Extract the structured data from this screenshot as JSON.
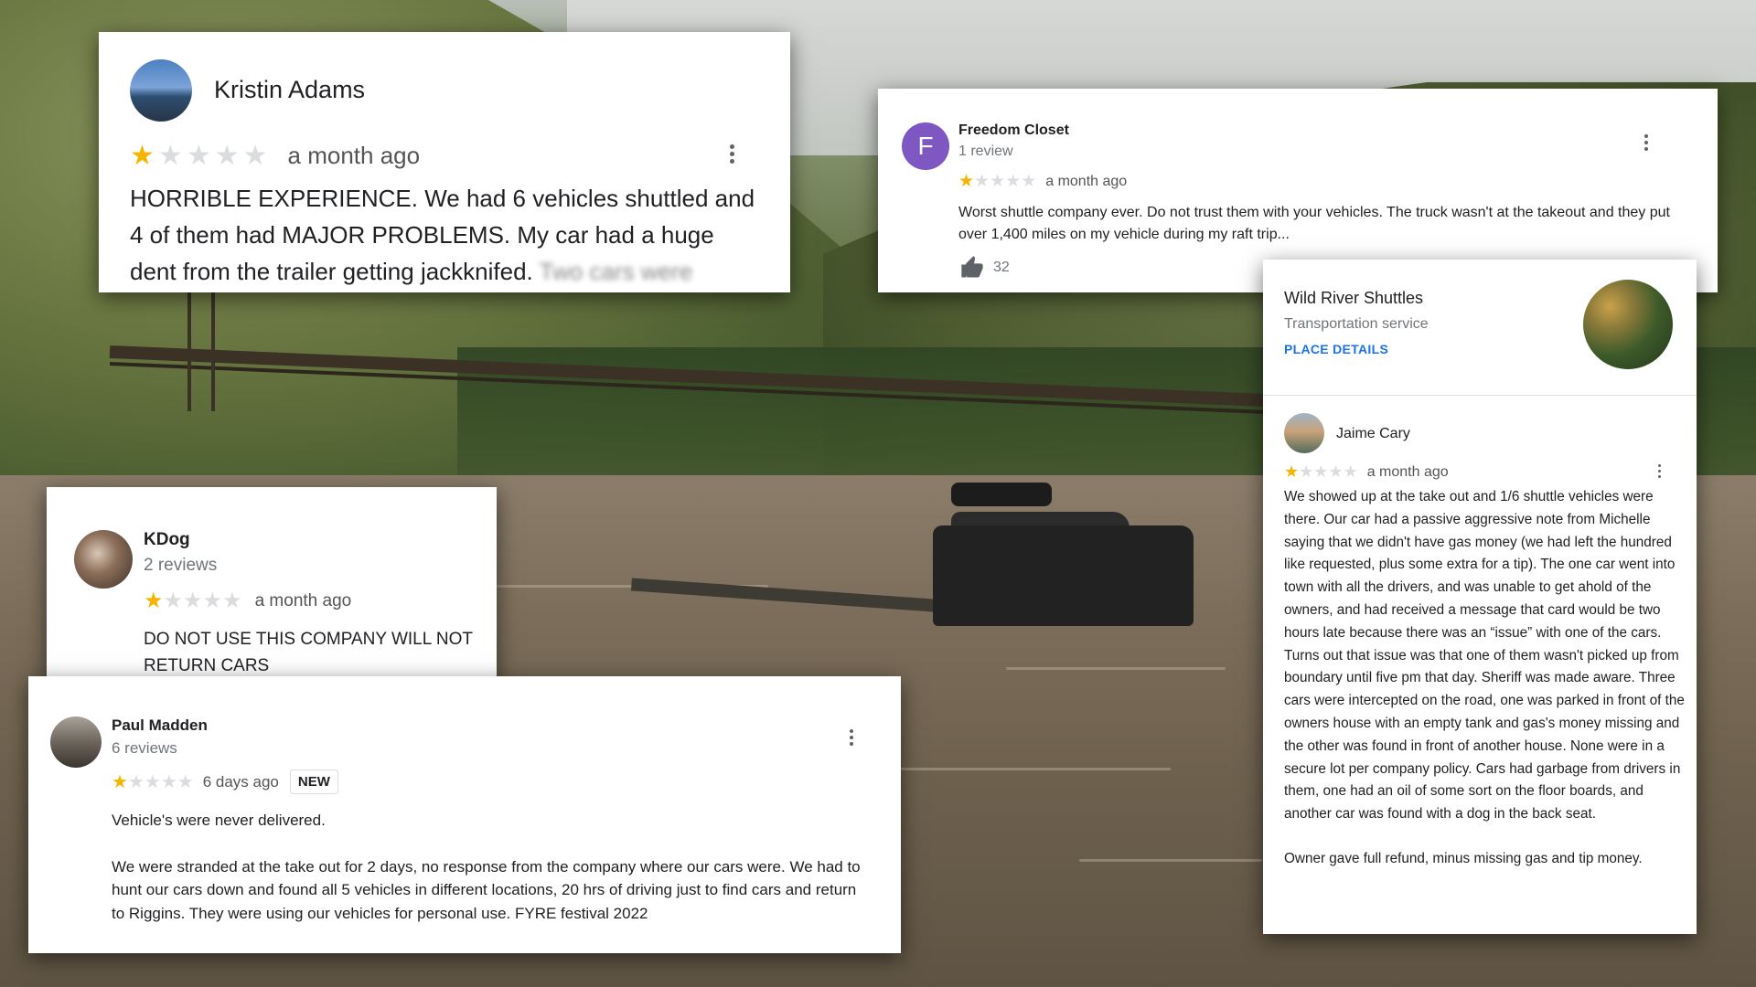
{
  "reviews": {
    "kristin": {
      "name": "Kristin Adams",
      "stars_filled": 1,
      "stars_total": 5,
      "time": "a month ago",
      "text": "HORRIBLE EXPERIENCE.  We had 6 vehicles shuttled and 4 of them had MAJOR PROBLEMS.  My car had a huge dent from the trailer getting jackknifed.",
      "text_blurred": "Two cars were"
    },
    "freedom": {
      "avatar_letter": "F",
      "name": "Freedom Closet",
      "review_count": "1 review",
      "stars_filled": 1,
      "time": "a month ago",
      "text": "Worst shuttle company ever. Do not trust them with your vehicles. The truck wasn't at the takeout and they put over 1,400 miles on my vehicle during my raft trip...",
      "likes": "32"
    },
    "wild_river": {
      "business_name": "Wild River Shuttles",
      "business_type": "Transportation service",
      "place_details": "PLACE DETAILS",
      "reviewer": "Jaime Cary",
      "stars_filled": 1,
      "time": "a month ago",
      "paragraph1": "We showed up at the take out and 1/6 shuttle vehicles were there. Our car had a passive aggressive note from Michelle saying that we didn't have gas money (we had left the hundred like requested, plus some extra for a tip). The one car went into town with all the drivers, and was unable to get ahold of the owners, and had received a message that card would be two hours late because there was an “issue” with one of the cars. Turns out that issue was that one of them wasn't picked up from boundary until five pm that day. Sheriff was made aware. Three cars were intercepted on the road, one was parked in front of the owners house with an empty tank and gas's money missing and the other was found in front of another house. None were in a secure lot per company policy. Cars had garbage from drivers in them, one had an oil of some sort on the floor boards, and another car was found with a dog in the back seat.",
      "paragraph2": "Owner gave full refund, minus missing gas and tip money."
    },
    "kdog": {
      "name": "KDog",
      "review_count": "2 reviews",
      "stars_filled": 1,
      "time": "a month ago",
      "text": "DO NOT USE THIS COMPANY WILL NOT RETURN CARS"
    },
    "paul": {
      "name": "Paul Madden",
      "review_count": "6 reviews",
      "stars_filled": 1,
      "time": "6 days ago",
      "badge": "NEW",
      "paragraph1": "Vehicle's were never delivered.",
      "paragraph2": "We were stranded at the take out for 2 days, no response from the company where our cars were. We had to hunt our cars down and found all 5 vehicles in different locations,  20 hrs of driving just to find cars and return to Riggins. They were using our vehicles for personal use. FYRE festival 2022"
    }
  },
  "colors": {
    "star_filled": "#f4b400",
    "star_empty": "#dadce0",
    "link_blue": "#1a73e8",
    "avatar_purple": "#7e57c2"
  },
  "icons": {
    "star": "★",
    "thumb": "thumb-up-icon",
    "more": "more-vert-icon"
  }
}
